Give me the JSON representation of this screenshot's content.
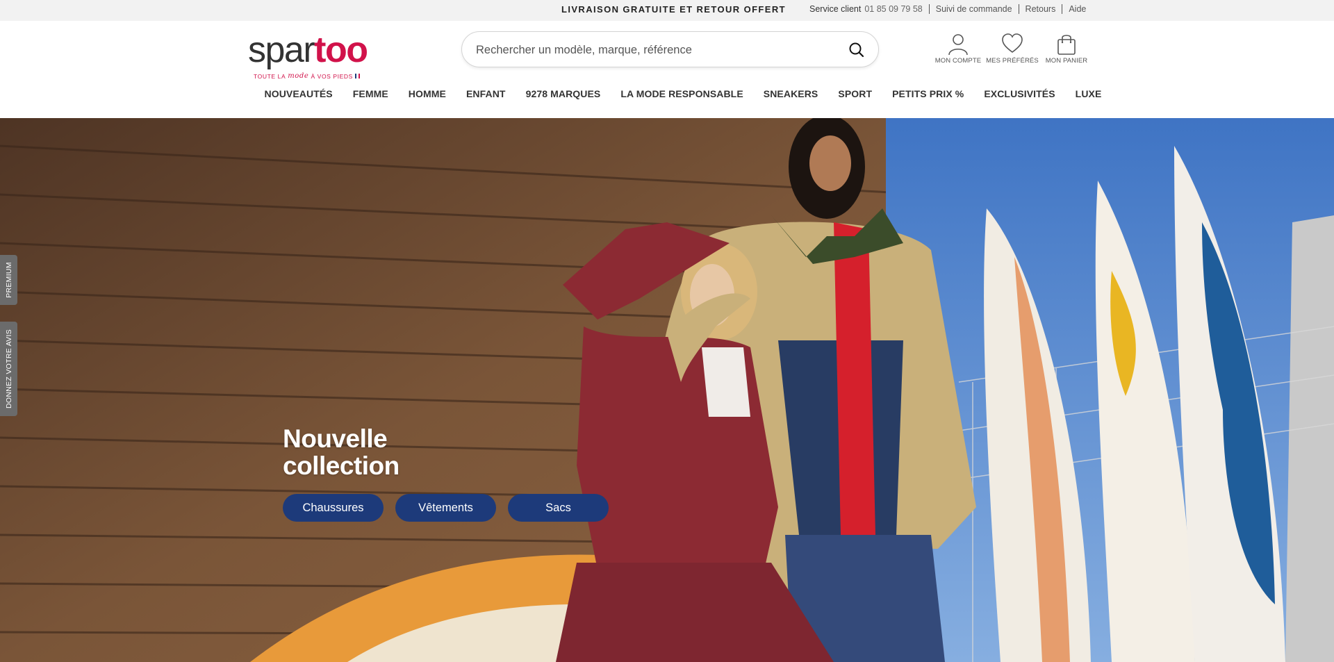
{
  "topbar": {
    "promo": "LIVRAISON GRATUITE ET RETOUR OFFERT",
    "service_label": "Service client",
    "phone": "01 85 09 79 58",
    "links": [
      "Suivi de commande",
      "Retours",
      "Aide"
    ]
  },
  "logo": {
    "part1": "spar",
    "part2": "too",
    "tagline_pre": "TOUTE LA",
    "tagline_script": "mode",
    "tagline_post": "À VOS PIEDS",
    "brand_color": "#d1124a"
  },
  "search": {
    "placeholder": "Rechercher un modèle, marque, référence",
    "icon": "search-icon"
  },
  "account": {
    "items": [
      {
        "label": "MON COMPTE",
        "icon": "user-icon"
      },
      {
        "label": "MES PRÉFÉRÉS",
        "icon": "heart-icon"
      },
      {
        "label": "MON PANIER",
        "icon": "bag-icon"
      }
    ]
  },
  "nav": {
    "items": [
      "NOUVEAUTÉS",
      "FEMME",
      "HOMME",
      "ENFANT",
      "9278 MARQUES",
      "LA MODE RESPONSABLE",
      "SNEAKERS",
      "SPORT",
      "PETITS PRIX %",
      "EXCLUSIVITÉS",
      "LUXE"
    ]
  },
  "hero": {
    "title_line1": "Nouvelle",
    "title_line2": "collection",
    "buttons": [
      "Chaussures",
      "Vêtements",
      "Sacs"
    ],
    "button_color": "#1d3a7a"
  },
  "side_tabs": {
    "premium": "PREMIUM",
    "avis": "DONNEZ VOTRE AVIS"
  }
}
